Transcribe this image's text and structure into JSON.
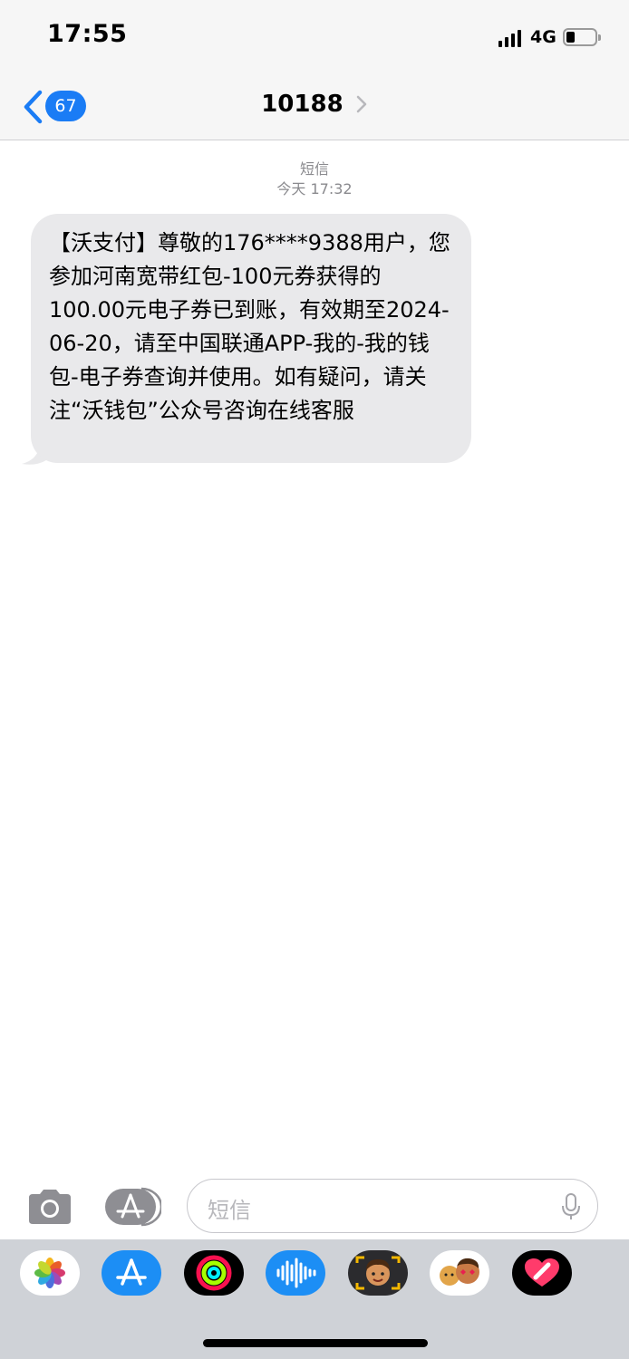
{
  "status_bar": {
    "time": "17:55",
    "network": "4G",
    "battery_level": 0.3
  },
  "nav": {
    "back_badge": "67",
    "contact": "10188"
  },
  "thread": {
    "service": "短信",
    "timestamp": "今天 17:32",
    "messages": [
      {
        "text": "【沃支付】尊敬的176****9388用户，您参加河南宽带红包-100元券获得的100.00元电子券已到账，有效期至2024-06-20，请至中国联通APP-我的-我的钱包-电子券查询并使用。如有疑问，请关注“沃钱包”公众号咨询在线客服"
      }
    ]
  },
  "input": {
    "placeholder": "短信"
  },
  "app_strip": [
    {
      "icon": "photos-icon"
    },
    {
      "icon": "app-store-icon"
    },
    {
      "icon": "fitness-icon"
    },
    {
      "icon": "audio-message-icon"
    },
    {
      "icon": "memoji-icon"
    },
    {
      "icon": "memoji-stickers-icon"
    },
    {
      "icon": "digital-touch-icon"
    }
  ],
  "colors": {
    "accent": "#1a7cf5",
    "bubble": "#e9e9eb",
    "header_bg": "#f6f6f6",
    "app_strip_bg": "#cfd2d7"
  }
}
